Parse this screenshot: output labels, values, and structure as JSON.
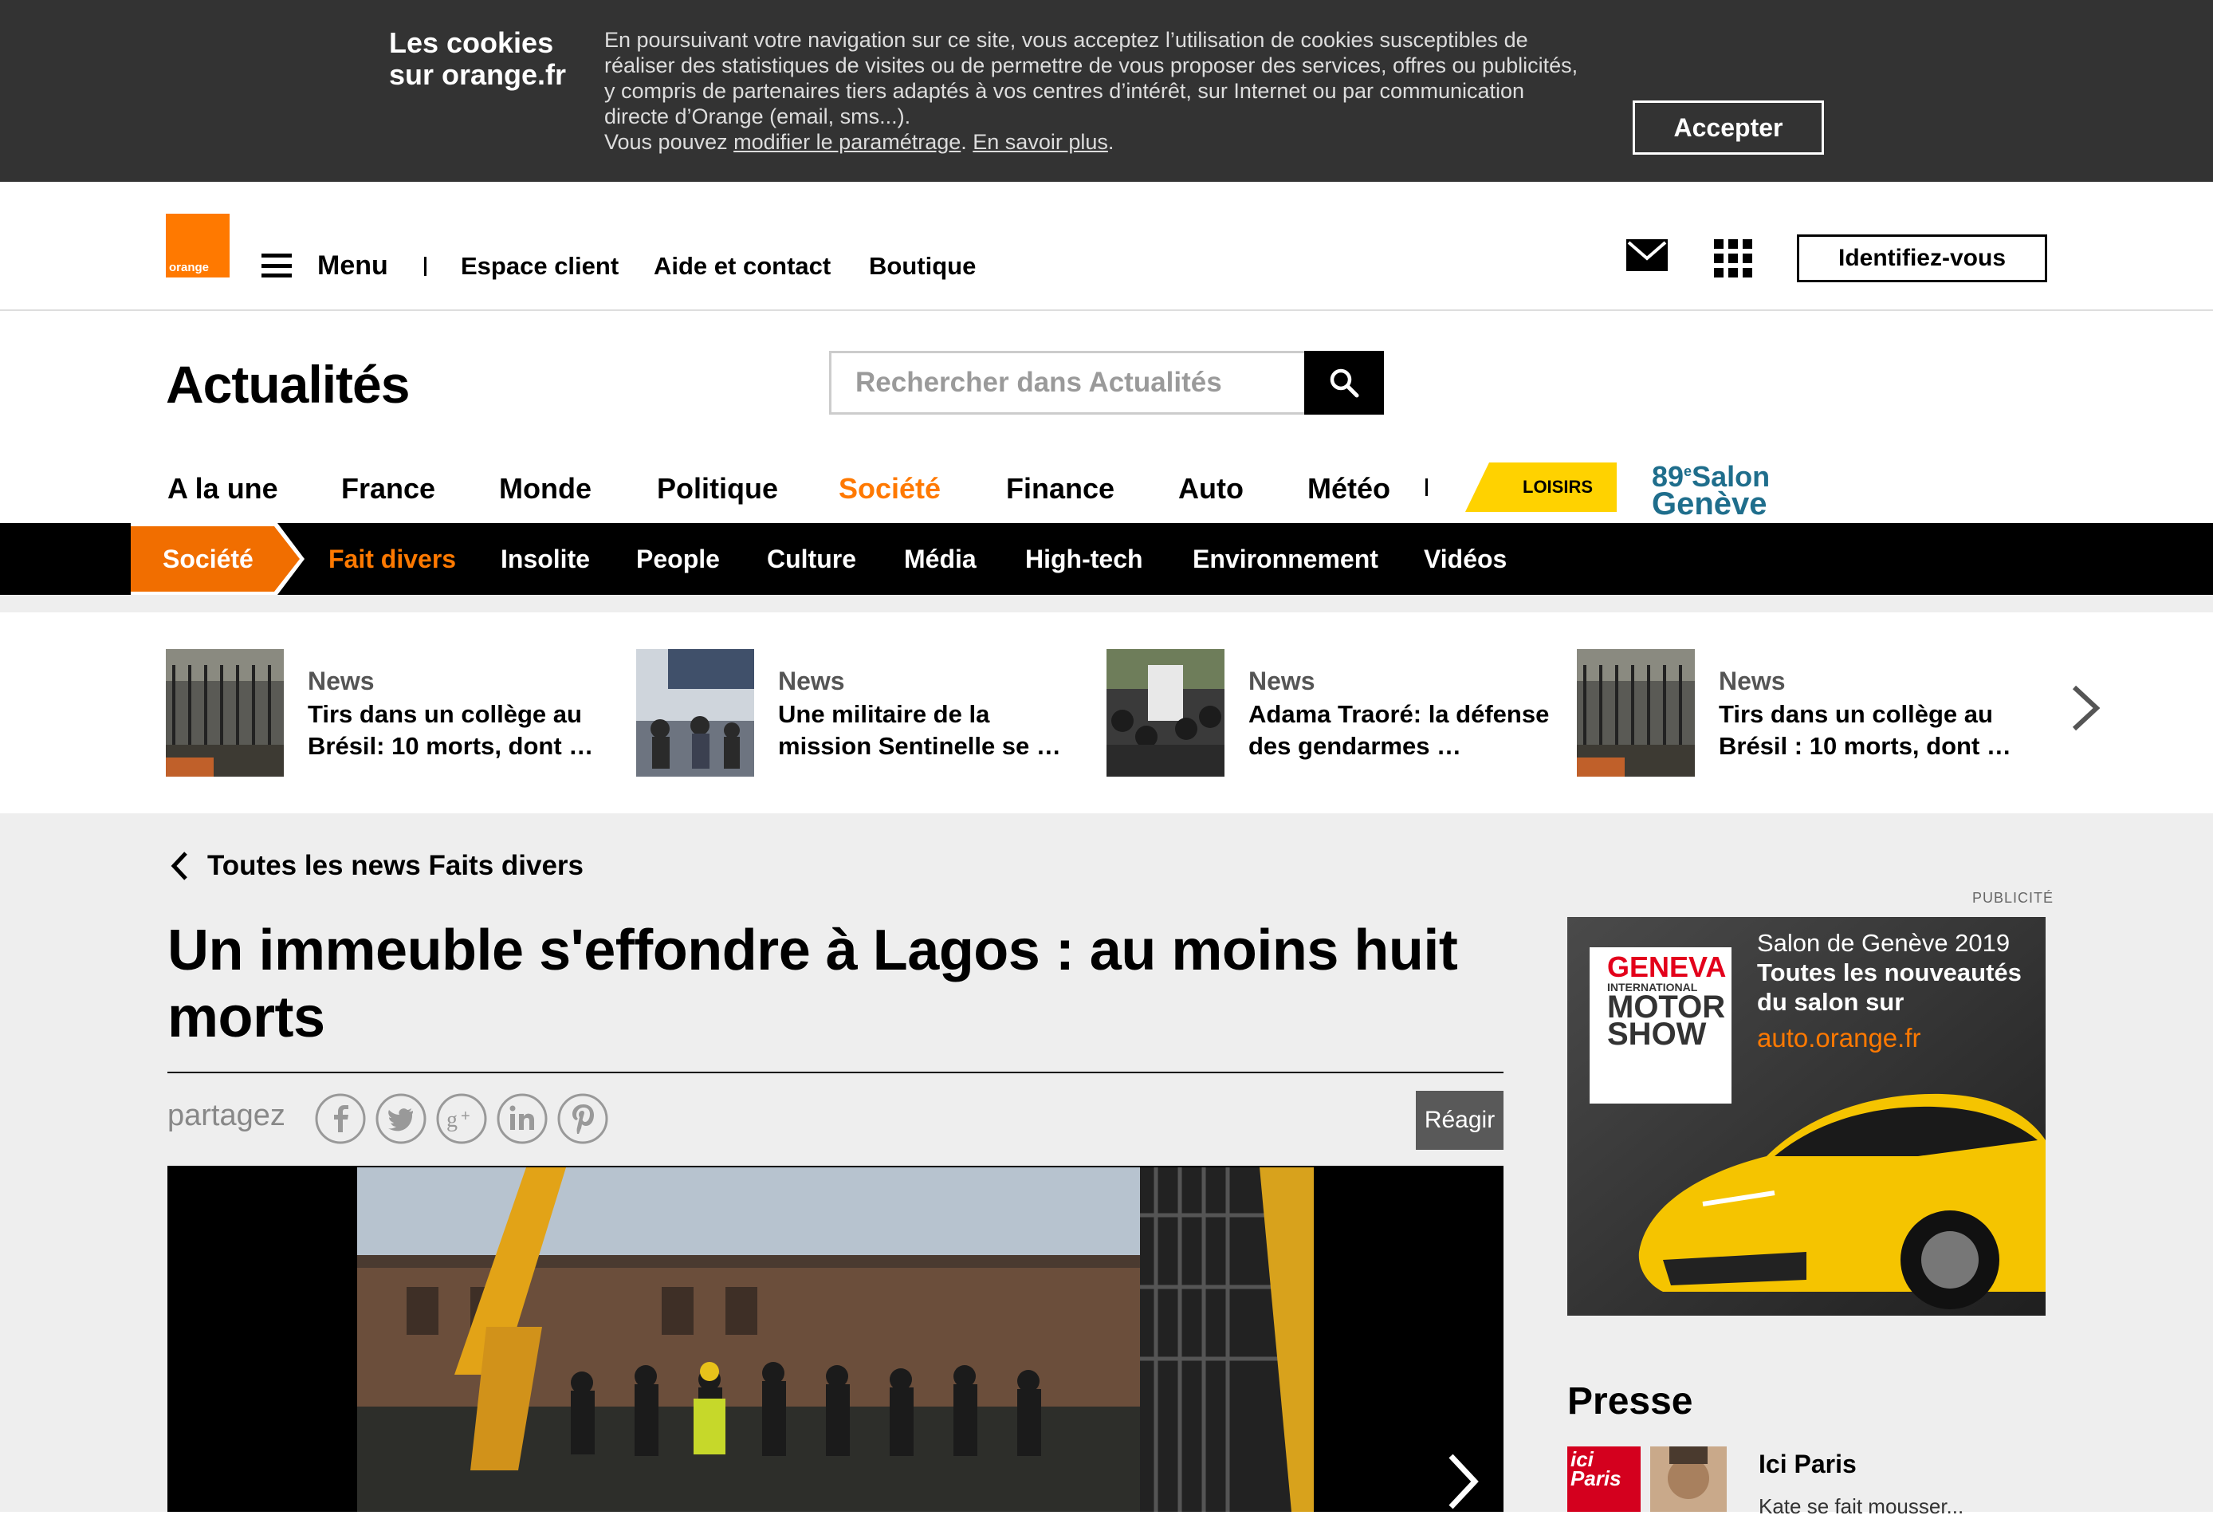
{
  "cookie": {
    "title": "Les cookies sur orange.fr",
    "text": "En poursuivant votre navigation sur ce site, vous acceptez l’utilisation de cookies susceptibles de réaliser des statistiques de visites ou de permettre de vous proposer des services, offres ou publicités, y compris de partenaires tiers adaptés à vos centres d’intérêt, sur Internet ou par communication directe d’Orange (email, sms...).",
    "text2_prefix": "Vous pouvez ",
    "link_settings": "modifier le paramétrage",
    "link_more": "En savoir plus",
    "accept": "Accepter"
  },
  "header": {
    "logo_text": "orange",
    "menu": "Menu",
    "links": [
      "Espace client",
      "Aide et contact",
      "Boutique"
    ],
    "login": "Identifiez-vous"
  },
  "section": {
    "title": "Actualités",
    "search_placeholder": "Rechercher dans Actualités"
  },
  "main_nav": [
    "A la une",
    "France",
    "Monde",
    "Politique",
    "Société",
    "Finance",
    "Auto",
    "Météo"
  ],
  "main_nav_active": "Société",
  "loisirs": "LOISIRS",
  "salon": {
    "num": "89",
    "sup": "e",
    "word1": "Salon",
    "word2": "Genève"
  },
  "sub_nav": {
    "active_section": "Société",
    "items": [
      "Fait divers",
      "Insolite",
      "People",
      "Culture",
      "Média",
      "High-tech",
      "Environnement",
      "Vidéos"
    ]
  },
  "news_strip": [
    {
      "category": "News",
      "title": "Tirs dans un collège au Brésil: 10 morts, dont …"
    },
    {
      "category": "News",
      "title": "Une militaire de la mission Sentinelle se …"
    },
    {
      "category": "News",
      "title": "Adama Traoré: la défense des gendarmes …"
    },
    {
      "category": "News",
      "title": "Tirs dans un collège au Brésil : 10 morts, dont …"
    }
  ],
  "article": {
    "back": "Toutes les news Faits divers",
    "headline": "Un immeuble s'effondre à Lagos : au moins huit morts",
    "share_label": "partagez",
    "react": "Réagir"
  },
  "sidebar": {
    "pub_label": "PUBLICITÉ",
    "ad": {
      "logo_l1": "GENEVA",
      "logo_l2": "INTERNATIONAL",
      "logo_l3": "MOTOR",
      "logo_l4": "SHOW",
      "line1": "Salon de Genève 2019",
      "line2": "Toutes les nouveautés",
      "line3": "du salon sur",
      "line4": "auto.orange.fr"
    },
    "presse_title": "Presse",
    "presse_name": "Ici Paris",
    "presse_thumb_logo": "ici Paris",
    "presse_sub": "Kate se fait mousser..."
  },
  "colors": {
    "brand": "#ff7900",
    "cookie_bg": "#333333",
    "salon": "#1f6e8c",
    "loisirs": "#ffd200"
  }
}
